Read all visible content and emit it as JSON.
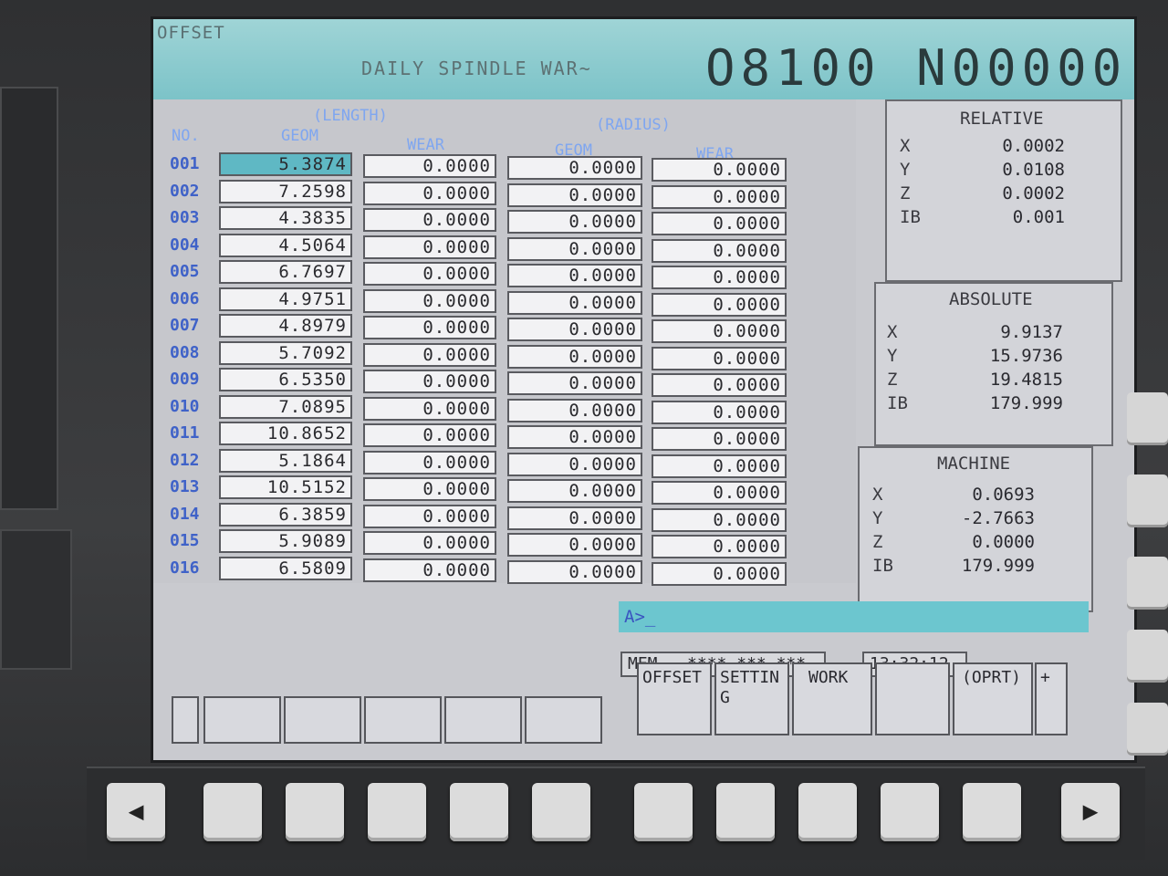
{
  "header": {
    "mode": "OFFSET",
    "program_name": "DAILY SPINDLE WAR~",
    "program_number": "O8100 N00000"
  },
  "table": {
    "group_length": "(LENGTH)",
    "group_radius": "(RADIUS)",
    "col_no": "NO.",
    "col_length_geom": "GEOM",
    "col_length_wear": "WEAR",
    "col_radius_geom": "GEOM",
    "col_radius_wear": "WEAR",
    "rows": [
      {
        "no": "001",
        "lg": "5.3874",
        "lw": "0.0000",
        "rg": "0.0000",
        "rw": "0.0000"
      },
      {
        "no": "002",
        "lg": "7.2598",
        "lw": "0.0000",
        "rg": "0.0000",
        "rw": "0.0000"
      },
      {
        "no": "003",
        "lg": "4.3835",
        "lw": "0.0000",
        "rg": "0.0000",
        "rw": "0.0000"
      },
      {
        "no": "004",
        "lg": "4.5064",
        "lw": "0.0000",
        "rg": "0.0000",
        "rw": "0.0000"
      },
      {
        "no": "005",
        "lg": "6.7697",
        "lw": "0.0000",
        "rg": "0.0000",
        "rw": "0.0000"
      },
      {
        "no": "006",
        "lg": "4.9751",
        "lw": "0.0000",
        "rg": "0.0000",
        "rw": "0.0000"
      },
      {
        "no": "007",
        "lg": "4.8979",
        "lw": "0.0000",
        "rg": "0.0000",
        "rw": "0.0000"
      },
      {
        "no": "008",
        "lg": "5.7092",
        "lw": "0.0000",
        "rg": "0.0000",
        "rw": "0.0000"
      },
      {
        "no": "009",
        "lg": "6.5350",
        "lw": "0.0000",
        "rg": "0.0000",
        "rw": "0.0000"
      },
      {
        "no": "010",
        "lg": "7.0895",
        "lw": "0.0000",
        "rg": "0.0000",
        "rw": "0.0000"
      },
      {
        "no": "011",
        "lg": "10.8652",
        "lw": "0.0000",
        "rg": "0.0000",
        "rw": "0.0000"
      },
      {
        "no": "012",
        "lg": "5.1864",
        "lw": "0.0000",
        "rg": "0.0000",
        "rw": "0.0000"
      },
      {
        "no": "013",
        "lg": "10.5152",
        "lw": "0.0000",
        "rg": "0.0000",
        "rw": "0.0000"
      },
      {
        "no": "014",
        "lg": "6.3859",
        "lw": "0.0000",
        "rg": "0.0000",
        "rw": "0.0000"
      },
      {
        "no": "015",
        "lg": "5.9089",
        "lw": "0.0000",
        "rg": "0.0000",
        "rw": "0.0000"
      },
      {
        "no": "016",
        "lg": "6.5809",
        "lw": "0.0000",
        "rg": "0.0000",
        "rw": "0.0000"
      }
    ]
  },
  "relative": {
    "title": "RELATIVE",
    "axes": [
      {
        "a": "X",
        "v": "0.0002"
      },
      {
        "a": "Y",
        "v": "0.0108"
      },
      {
        "a": "Z",
        "v": "0.0002"
      },
      {
        "a": "IB",
        "v": "0.001"
      }
    ]
  },
  "absolute": {
    "title": "ABSOLUTE",
    "axes": [
      {
        "a": "X",
        "v": "9.9137"
      },
      {
        "a": "Y",
        "v": "15.9736"
      },
      {
        "a": "Z",
        "v": "19.4815"
      },
      {
        "a": "IB",
        "v": "179.999"
      }
    ]
  },
  "machine": {
    "title": "MACHINE",
    "axes": [
      {
        "a": "X",
        "v": "0.0693"
      },
      {
        "a": "Y",
        "v": "-2.7663"
      },
      {
        "a": "Z",
        "v": "0.0000"
      },
      {
        "a": "IB",
        "v": "179.999"
      }
    ]
  },
  "input": {
    "prompt": "A>_"
  },
  "status": {
    "mode": "MEM",
    "state1": "****",
    "state2": "***",
    "state3": "***",
    "time": "13:32:12"
  },
  "softkeys": {
    "offset": "OFFSET",
    "setting": "SETTIN\nG",
    "work": "WORK",
    "oprt": "(OPRT)",
    "next": "+"
  },
  "buttons": {
    "prev": "◀",
    "next": "▶"
  }
}
